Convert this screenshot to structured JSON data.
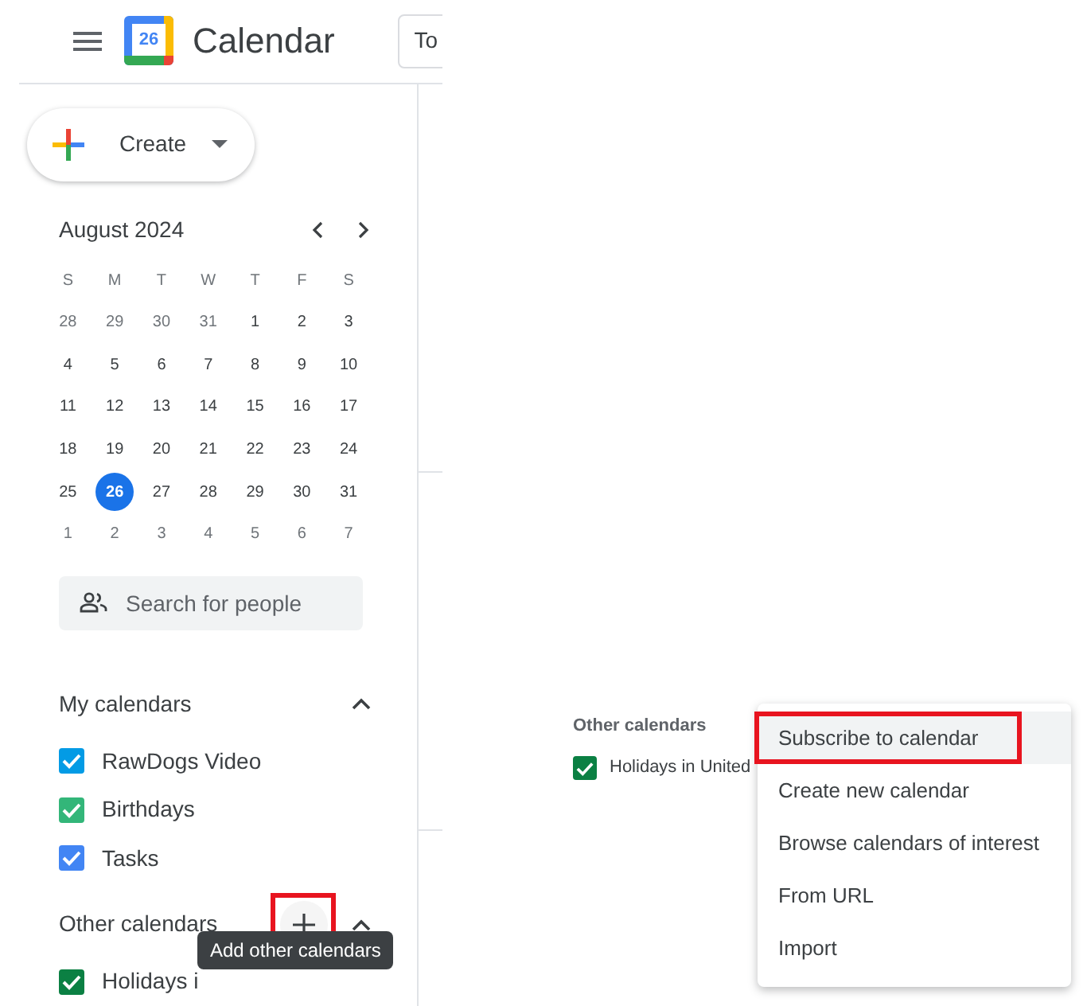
{
  "header": {
    "logo_number": "26",
    "title": "Calendar",
    "today_button": "To"
  },
  "create_button": {
    "label": "Create"
  },
  "mini_calendar": {
    "month": "August 2024",
    "weekdays": [
      "S",
      "M",
      "T",
      "W",
      "T",
      "F",
      "S"
    ],
    "weeks": [
      [
        {
          "day": "28",
          "outside": true,
          "selected": false
        },
        {
          "day": "29",
          "outside": true,
          "selected": false
        },
        {
          "day": "30",
          "outside": true,
          "selected": false
        },
        {
          "day": "31",
          "outside": true,
          "selected": false
        },
        {
          "day": "1",
          "outside": false,
          "selected": false
        },
        {
          "day": "2",
          "outside": false,
          "selected": false
        },
        {
          "day": "3",
          "outside": false,
          "selected": false
        }
      ],
      [
        {
          "day": "4",
          "outside": false,
          "selected": false
        },
        {
          "day": "5",
          "outside": false,
          "selected": false
        },
        {
          "day": "6",
          "outside": false,
          "selected": false
        },
        {
          "day": "7",
          "outside": false,
          "selected": false
        },
        {
          "day": "8",
          "outside": false,
          "selected": false
        },
        {
          "day": "9",
          "outside": false,
          "selected": false
        },
        {
          "day": "10",
          "outside": false,
          "selected": false
        }
      ],
      [
        {
          "day": "11",
          "outside": false,
          "selected": false
        },
        {
          "day": "12",
          "outside": false,
          "selected": false
        },
        {
          "day": "13",
          "outside": false,
          "selected": false
        },
        {
          "day": "14",
          "outside": false,
          "selected": false
        },
        {
          "day": "15",
          "outside": false,
          "selected": false
        },
        {
          "day": "16",
          "outside": false,
          "selected": false
        },
        {
          "day": "17",
          "outside": false,
          "selected": false
        }
      ],
      [
        {
          "day": "18",
          "outside": false,
          "selected": false
        },
        {
          "day": "19",
          "outside": false,
          "selected": false
        },
        {
          "day": "20",
          "outside": false,
          "selected": false
        },
        {
          "day": "21",
          "outside": false,
          "selected": false
        },
        {
          "day": "22",
          "outside": false,
          "selected": false
        },
        {
          "day": "23",
          "outside": false,
          "selected": false
        },
        {
          "day": "24",
          "outside": false,
          "selected": false
        }
      ],
      [
        {
          "day": "25",
          "outside": false,
          "selected": false
        },
        {
          "day": "26",
          "outside": false,
          "selected": true
        },
        {
          "day": "27",
          "outside": false,
          "selected": false
        },
        {
          "day": "28",
          "outside": false,
          "selected": false
        },
        {
          "day": "29",
          "outside": false,
          "selected": false
        },
        {
          "day": "30",
          "outside": false,
          "selected": false
        },
        {
          "day": "31",
          "outside": false,
          "selected": false
        }
      ],
      [
        {
          "day": "1",
          "outside": true,
          "selected": false
        },
        {
          "day": "2",
          "outside": true,
          "selected": false
        },
        {
          "day": "3",
          "outside": true,
          "selected": false
        },
        {
          "day": "4",
          "outside": true,
          "selected": false
        },
        {
          "day": "5",
          "outside": true,
          "selected": false
        },
        {
          "day": "6",
          "outside": true,
          "selected": false
        },
        {
          "day": "7",
          "outside": true,
          "selected": false
        }
      ]
    ]
  },
  "people_search": {
    "placeholder": "Search for people"
  },
  "my_calendars": {
    "title": "My calendars",
    "expanded": true,
    "items": [
      {
        "label": "RawDogs Video",
        "checked": true,
        "color": "#039be5"
      },
      {
        "label": "Birthdays",
        "checked": true,
        "color": "#33b679"
      },
      {
        "label": "Tasks",
        "checked": true,
        "color": "#4285f4"
      }
    ]
  },
  "other_calendars": {
    "title": "Other calendars",
    "expanded": true,
    "add_highlighted": true,
    "tooltip": "Add other calendars",
    "items": [
      {
        "label": "Holidays i",
        "checked": true,
        "color": "#0b8043"
      }
    ]
  },
  "detail_panel": {
    "title": "Other calendars",
    "items": [
      {
        "label": "Holidays in United",
        "checked": true,
        "color": "#0b8043"
      }
    ],
    "menu": [
      {
        "label": "Subscribe to calendar",
        "highlighted": true
      },
      {
        "label": "Create new calendar",
        "highlighted": false
      },
      {
        "label": "Browse calendars of interest",
        "highlighted": false
      },
      {
        "label": "From URL",
        "highlighted": false
      },
      {
        "label": "Import",
        "highlighted": false
      }
    ]
  }
}
